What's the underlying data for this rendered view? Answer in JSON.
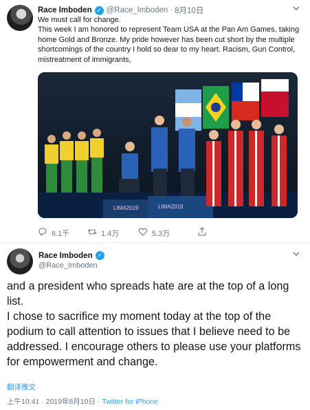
{
  "tweet1": {
    "name": "Race Imboden",
    "handle": "@Race_Imboden",
    "separator": "·",
    "time": "8月10日",
    "lines": [
      "We must call for change.",
      "This week I am honored to represent Team USA at the Pan Am Games, taking home Gold and Bronze. My pride however has been cut short by the multiple shortcomings of the country I hold so dear to my heart. Racism, Gun Control, mistreatment of immigrants,"
    ],
    "media": {
      "banner_text": "LIMA2019",
      "image_label": "podium-photo"
    },
    "actions": {
      "reply_count": "6.1千",
      "retweet_count": "1.4万",
      "like_count": "5.3万"
    }
  },
  "tweet2": {
    "name": "Race Imboden",
    "handle": "@Race_Imboden",
    "paragraphs": [
      "and a president who spreads hate are at the top of a long list.",
      "I chose to sacrifice my moment today at the top of the podium to call attention to issues that I believe need to be addressed.  I encourage others to please use your platforms for empowerment and change."
    ],
    "translate_label": "翻译推文",
    "timestamp": "上午10:41 · 2019年8月10日 · ",
    "source": "Twitter for iPhone"
  },
  "icons": [
    "avatar",
    "verified-badge-icon",
    "chevron-down-icon",
    "reply-icon",
    "retweet-icon",
    "like-icon",
    "share-icon"
  ],
  "colors": {
    "link": "#1da1f2",
    "muted": "#657786",
    "text": "#14171a",
    "divider": "#e6ecf0"
  }
}
